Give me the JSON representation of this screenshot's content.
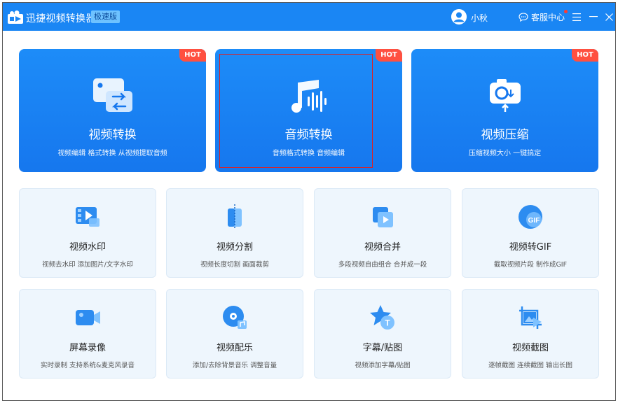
{
  "app": {
    "title": "迅捷视频转换器",
    "edition": "极速版",
    "username": "小秋",
    "service_label": "客服中心",
    "icons": {
      "logo": "app-logo-icon",
      "avatar": "user-avatar-icon",
      "service": "chat-bubble-icon",
      "menu": "hamburger-menu-icon",
      "minimize": "minimize-icon",
      "close": "close-icon"
    }
  },
  "colors": {
    "primary": "#1a86f4",
    "hot": "#ff5040",
    "card_bg": "#eef6fd",
    "highlight": "#e02020"
  },
  "features": [
    {
      "title": "视频转换",
      "desc": "视频编辑 格式转换 从视频提取音频",
      "badge": "HOT",
      "icon": "video-convert-icon"
    },
    {
      "title": "音频转换",
      "desc": "音频格式转换 音频编辑",
      "badge": "HOT",
      "icon": "audio-convert-icon",
      "selected": true
    },
    {
      "title": "视频压缩",
      "desc": "压缩视频大小 一键搞定",
      "badge": "HOT",
      "icon": "camera-compress-icon"
    }
  ],
  "tools": [
    {
      "title": "视频水印",
      "desc": "视频去水印 添加图片/文字水印",
      "icon": "watermark-icon"
    },
    {
      "title": "视频分割",
      "desc": "视频长度切割 画面裁剪",
      "icon": "split-icon"
    },
    {
      "title": "视频合并",
      "desc": "多段视频自由组合 合并成一段",
      "icon": "merge-icon"
    },
    {
      "title": "视频转GIF",
      "desc": "截取视频片段 制作成GIF",
      "icon": "gif-icon",
      "icon_text": "GIF"
    },
    {
      "title": "屏幕录像",
      "desc": "实时录制 支持系统&麦克风录音",
      "icon": "screen-record-icon"
    },
    {
      "title": "视频配乐",
      "desc": "添加/去除背景音乐 调整音量",
      "icon": "music-disc-icon"
    },
    {
      "title": "字幕/贴图",
      "desc": "视频添加字幕/贴图",
      "icon": "subtitle-sticker-icon",
      "icon_text": "T"
    },
    {
      "title": "视频截图",
      "desc": "逐帧截图 连续截图 输出长图",
      "icon": "screenshot-icon"
    }
  ]
}
